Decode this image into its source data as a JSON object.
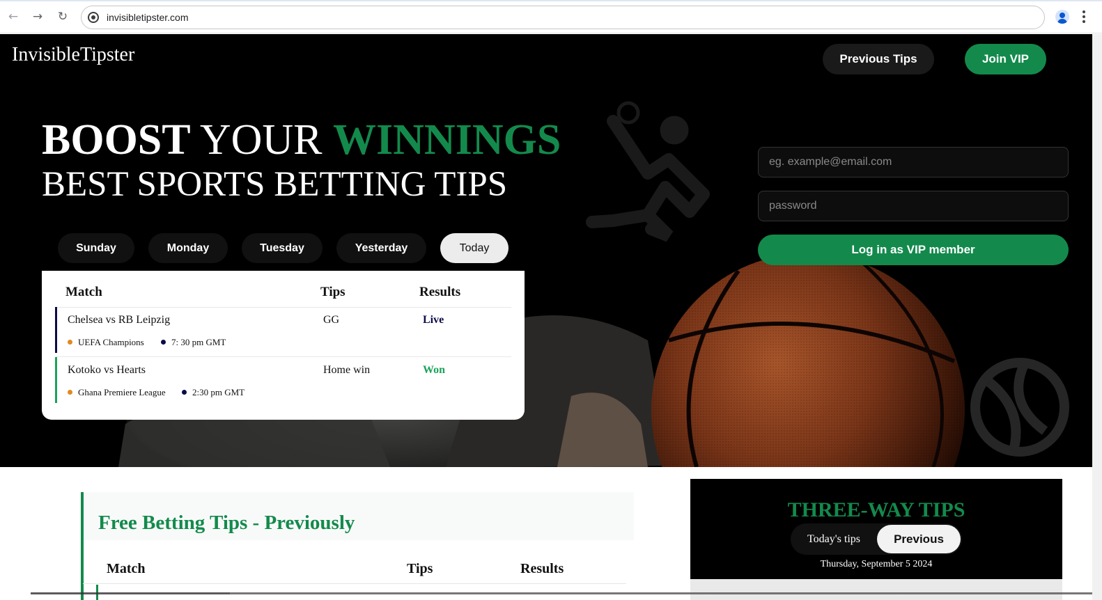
{
  "browser": {
    "url": "invisibletipster.com",
    "back_icon": "←",
    "forward_icon": "→",
    "reload_icon": "↻"
  },
  "header": {
    "logo": "InvisibleTipster",
    "previous_tips_label": "Previous Tips",
    "join_vip_label": "Join VIP"
  },
  "hero": {
    "headline_bold": "BOOST",
    "headline_plain": "YOUR",
    "headline_accent": "WINNINGS",
    "subheadline": "BEST SPORTS BETTING TIPS"
  },
  "day_tabs": [
    {
      "label": "Sunday",
      "active": false
    },
    {
      "label": "Monday",
      "active": false
    },
    {
      "label": "Tuesday",
      "active": false
    },
    {
      "label": "Yesterday",
      "active": false
    },
    {
      "label": "Today",
      "active": true
    }
  ],
  "tips_table": {
    "headers": {
      "match": "Match",
      "tips": "Tips",
      "results": "Results"
    },
    "rows": [
      {
        "match": "Chelsea vs RB Leipzig",
        "tip": "GG",
        "result": "Live",
        "league": "UEFA Champions",
        "time": "7: 30 pm GMT",
        "bar_color": "#0b0b4a",
        "result_color": "#0b0b4a"
      },
      {
        "match": "Kotoko vs Hearts",
        "tip": "Home win",
        "result": "Won",
        "league": "Ghana Premiere League",
        "time": "2:30 pm GMT",
        "bar_color": "#19a35a",
        "result_color": "#19a35a"
      }
    ]
  },
  "login": {
    "email_placeholder": "eg. example@email.com",
    "password_placeholder": "password",
    "submit_label": "Log in as VIP member"
  },
  "free_tips": {
    "title": "Free Betting Tips - Previously",
    "headers": {
      "match": "Match",
      "tips": "Tips",
      "results": "Results"
    }
  },
  "three_way": {
    "title": "THREE-WAY TIPS",
    "todays_label": "Today's tips",
    "previous_label": "Previous",
    "date": "Thursday, September 5 2024"
  },
  "colors": {
    "brand_green": "#138a4c",
    "league_dot": "#e08a1e",
    "time_dot": "#0b0b4a"
  }
}
